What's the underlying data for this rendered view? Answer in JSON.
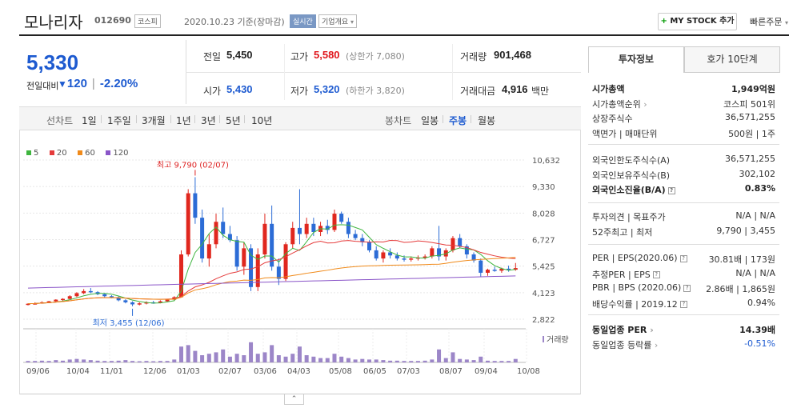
{
  "header": {
    "name": "모나리자",
    "code": "012690",
    "market_tag": "코스피",
    "date": "2020.10.23 기준(장마감)",
    "realtime_tag": "실시간",
    "company_tag": "기업개요",
    "mystock_label": "MY STOCK 추가",
    "quick_order": "빠른주문"
  },
  "quote": {
    "price": "5,330",
    "change_label": "전일대비",
    "change": "120",
    "change_pct": "-2.20%"
  },
  "stats": {
    "prev_close_label": "전일",
    "prev_close": "5,450",
    "high_label": "고가",
    "high": "5,580",
    "upper_limit": "(상한가 7,080)",
    "volume_label": "거래량",
    "volume": "901,468",
    "open_label": "시가",
    "open": "5,430",
    "low_label": "저가",
    "low": "5,320",
    "lower_limit": "(하한가 3,820)",
    "amount_label": "거래대금",
    "amount": "4,916",
    "amount_unit": "백만"
  },
  "tabs": {
    "line_label": "선차트",
    "periods": [
      "1일",
      "1주일",
      "3개월",
      "1년",
      "3년",
      "5년",
      "10년"
    ],
    "candle_label": "봉차트",
    "candle": [
      "일봉",
      "주봉",
      "월봉"
    ],
    "active_candle": "주봉"
  },
  "chart_data": {
    "type": "candlestick",
    "legend": [
      {
        "name": "5",
        "color": "#3fb53f"
      },
      {
        "name": "20",
        "color": "#e53b3b"
      },
      {
        "name": "60",
        "color": "#f08a1a"
      },
      {
        "name": "120",
        "color": "#8a55c8"
      }
    ],
    "y_ticks": [
      "10,632",
      "9,330",
      "8,028",
      "6,727",
      "5,425",
      "4,123",
      "2,822"
    ],
    "ylim": [
      2822,
      10632
    ],
    "x_ticks": [
      "09/06",
      "10/04",
      "11/01",
      "12/06",
      "01/03",
      "02/07",
      "03/06",
      "04/03",
      "05/08",
      "06/05",
      "07/03",
      "08/07",
      "09/04",
      "10/08"
    ],
    "max_annotation": "최고 9,790 (02/07)",
    "min_annotation": "최저 3,455 (12/06)",
    "volume_label": "거래량",
    "candles": [
      [
        3550,
        3600,
        3500,
        3580
      ],
      [
        3580,
        3650,
        3540,
        3600
      ],
      [
        3600,
        3700,
        3580,
        3650
      ],
      [
        3650,
        3720,
        3620,
        3700
      ],
      [
        3700,
        3800,
        3660,
        3780
      ],
      [
        3780,
        3850,
        3720,
        3820
      ],
      [
        3820,
        4000,
        3800,
        3950
      ],
      [
        3950,
        4150,
        3900,
        4100
      ],
      [
        4100,
        4300,
        4050,
        4200
      ],
      [
        4200,
        4350,
        4100,
        4150
      ],
      [
        4150,
        4200,
        4000,
        4050
      ],
      [
        4050,
        4100,
        3900,
        3950
      ],
      [
        3950,
        4000,
        3850,
        3900
      ],
      [
        3900,
        3950,
        3700,
        3750
      ],
      [
        3750,
        3800,
        3600,
        3650
      ],
      [
        3650,
        3700,
        3455,
        3550
      ],
      [
        3550,
        3650,
        3500,
        3600
      ],
      [
        3600,
        3700,
        3550,
        3650
      ],
      [
        3650,
        3720,
        3580,
        3620
      ],
      [
        3620,
        3750,
        3600,
        3700
      ],
      [
        3700,
        3800,
        3650,
        3780
      ],
      [
        3780,
        3950,
        3750,
        3900
      ],
      [
        3900,
        6200,
        3880,
        6000
      ],
      [
        6000,
        9200,
        5900,
        9000
      ],
      [
        9000,
        9790,
        7500,
        7800
      ],
      [
        7800,
        8200,
        5600,
        5800
      ],
      [
        5800,
        7000,
        5400,
        6500
      ],
      [
        6500,
        8000,
        6300,
        7600
      ],
      [
        7600,
        8300,
        6800,
        7000
      ],
      [
        7000,
        7400,
        6600,
        6700
      ],
      [
        6700,
        6900,
        5200,
        5400
      ],
      [
        5400,
        6600,
        5000,
        6300
      ],
      [
        6300,
        6500,
        4200,
        4400
      ],
      [
        4400,
        6300,
        4200,
        6000
      ],
      [
        6000,
        8000,
        5800,
        7500
      ],
      [
        7500,
        8400,
        5200,
        5400
      ],
      [
        5400,
        5800,
        4500,
        4800
      ],
      [
        4800,
        6600,
        4700,
        6500
      ],
      [
        6500,
        7600,
        6300,
        7300
      ],
      [
        7300,
        9200,
        6500,
        7000
      ],
      [
        7000,
        7800,
        6800,
        7500
      ],
      [
        7500,
        7800,
        6900,
        7100
      ],
      [
        7100,
        7600,
        6900,
        7400
      ],
      [
        7400,
        7700,
        7000,
        7200
      ],
      [
        7200,
        8200,
        7100,
        8000
      ],
      [
        8000,
        8100,
        7500,
        7600
      ],
      [
        7600,
        7800,
        6800,
        7000
      ],
      [
        7000,
        7200,
        6700,
        6800
      ],
      [
        6800,
        7000,
        6400,
        6600
      ],
      [
        6600,
        6700,
        6100,
        6200
      ],
      [
        6200,
        6400,
        5700,
        5800
      ],
      [
        5800,
        6200,
        5600,
        6100
      ],
      [
        6100,
        6300,
        5800,
        5950
      ],
      [
        5950,
        6100,
        5700,
        5800
      ],
      [
        5800,
        5950,
        5650,
        5750
      ],
      [
        5750,
        5900,
        5650,
        5800
      ],
      [
        5800,
        5950,
        5700,
        5850
      ],
      [
        5850,
        6000,
        5750,
        5900
      ],
      [
        5900,
        6400,
        5800,
        6300
      ],
      [
        6300,
        7400,
        5700,
        5900
      ],
      [
        5900,
        6300,
        5700,
        6200
      ],
      [
        6200,
        6900,
        6100,
        6800
      ],
      [
        6800,
        7000,
        6300,
        6400
      ],
      [
        6400,
        6500,
        5800,
        6000
      ],
      [
        6000,
        6100,
        5600,
        5700
      ],
      [
        5700,
        5800,
        4900,
        5100
      ],
      [
        5100,
        5300,
        4950,
        5250
      ],
      [
        5250,
        5400,
        5150,
        5200
      ],
      [
        5200,
        5350,
        5100,
        5300
      ],
      [
        5300,
        5450,
        5150,
        5250
      ],
      [
        5250,
        5580,
        5200,
        5330
      ]
    ]
  },
  "info": {
    "tab_on": "투자정보",
    "tab_off": "호가 10단계",
    "rows1": [
      {
        "k": "시가총액",
        "v": "1,949억원",
        "bold": true
      },
      {
        "k": "시가총액순위",
        "v": "코스피 501위",
        "arrow": true
      },
      {
        "k": "상장주식수",
        "v": "36,571,255"
      },
      {
        "k": "액면가 | 매매단위",
        "v": "500원 | 1주"
      }
    ],
    "rows2": [
      {
        "k": "외국인한도주식수(A)",
        "v": "36,571,255"
      },
      {
        "k": "외국인보유주식수(B)",
        "v": "302,102"
      },
      {
        "k": "외국인소진율(B/A)",
        "v": "0.83%",
        "bold": true,
        "help": true
      }
    ],
    "rows3": [
      {
        "k": "투자의견 | 목표주가",
        "v": "N/A | N/A"
      },
      {
        "k": "52주최고 | 최저",
        "v": "9,790 | 3,455"
      }
    ],
    "rows4": [
      {
        "k": "PER | EPS(2020.06)",
        "v": "30.81배 | 173원",
        "help": true
      },
      {
        "k": "추정PER | EPS",
        "v": "N/A | N/A",
        "help": true
      },
      {
        "k": "PBR | BPS (2020.06)",
        "v": "2.86배 | 1,865원",
        "help": true
      },
      {
        "k": "배당수익률 | 2019.12",
        "v": "0.94%",
        "help": true
      }
    ],
    "rows5": [
      {
        "k": "동일업종 PER",
        "v": "14.39배",
        "bold": true,
        "arrow": true
      },
      {
        "k": "동일업종 등락률",
        "v": "-0.51%",
        "arrow": true,
        "vblue": true
      }
    ]
  }
}
